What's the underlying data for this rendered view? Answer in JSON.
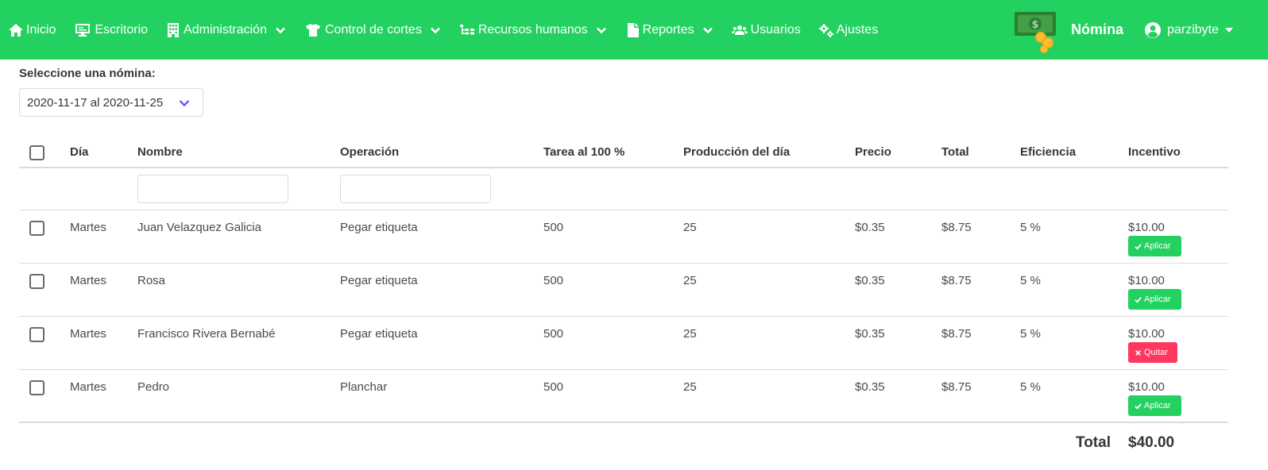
{
  "nav": {
    "items": [
      {
        "label": "Inicio",
        "icon": "home-icon",
        "dropdown": false
      },
      {
        "label": "Escritorio",
        "icon": "desktop-icon",
        "dropdown": false
      },
      {
        "label": "Administración",
        "icon": "building-icon",
        "dropdown": true
      },
      {
        "label": "Control de cortes",
        "icon": "tshirt-icon",
        "dropdown": true
      },
      {
        "label": "Recursos humanos",
        "icon": "sitemap-icon",
        "dropdown": true
      },
      {
        "label": "Reportes",
        "icon": "file-icon",
        "dropdown": true
      },
      {
        "label": "Usuarios",
        "icon": "users-icon",
        "dropdown": false
      },
      {
        "label": "Ajustes",
        "icon": "cogs-icon",
        "dropdown": false
      }
    ],
    "brand": "Nómina",
    "user": "parzibyte"
  },
  "selector": {
    "label": "Seleccione una nómina:",
    "value": "2020-11-17 al 2020-11-25"
  },
  "table": {
    "headers": [
      "Día",
      "Nombre",
      "Operación",
      "Tarea al 100 %",
      "Producción del día",
      "Precio",
      "Total",
      "Eficiencia",
      "Incentivo"
    ],
    "rows": [
      {
        "dia": "Martes",
        "nombre": "Juan Velazquez Galicia",
        "operacion": "Pegar etiqueta",
        "tarea": "500",
        "produccion": "25",
        "precio": "$0.35",
        "total": "$8.75",
        "eficiencia": "5 %",
        "incentivo": "$10.00",
        "action": "Aplicar",
        "action_type": "apply"
      },
      {
        "dia": "Martes",
        "nombre": "Rosa",
        "operacion": "Pegar etiqueta",
        "tarea": "500",
        "produccion": "25",
        "precio": "$0.35",
        "total": "$8.75",
        "eficiencia": "5 %",
        "incentivo": "$10.00",
        "action": "Aplicar",
        "action_type": "apply"
      },
      {
        "dia": "Martes",
        "nombre": "Francisco Rivera Bernabé",
        "operacion": "Pegar etiqueta",
        "tarea": "500",
        "produccion": "25",
        "precio": "$0.35",
        "total": "$8.75",
        "eficiencia": "5 %",
        "incentivo": "$10.00",
        "action": "Quitar",
        "action_type": "remove"
      },
      {
        "dia": "Martes",
        "nombre": "Pedro",
        "operacion": "Planchar",
        "tarea": "500",
        "produccion": "25",
        "precio": "$0.35",
        "total": "$8.75",
        "eficiencia": "5 %",
        "incentivo": "$10.00",
        "action": "Aplicar",
        "action_type": "apply"
      }
    ],
    "total_label": "Total",
    "total_value": "$40.00"
  },
  "colors": {
    "primary": "#23d160",
    "danger": "#ff3860",
    "accent": "#7c4dff"
  }
}
